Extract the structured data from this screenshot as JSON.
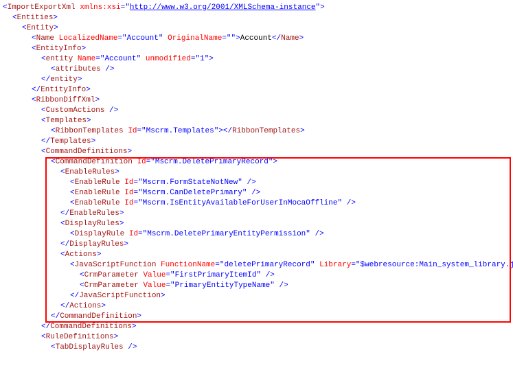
{
  "xml": {
    "root_tag": "ImportExportXml",
    "root_ns_attr": "xmlns:xsi",
    "root_ns_val": "http://www.w3.org/2001/XMLSchema-instance",
    "entities": "Entities",
    "entity": "Entity",
    "name_tag": "Name",
    "name_attr1": "LocalizedName",
    "name_val1": "Account",
    "name_attr2": "OriginalName",
    "name_val2": "",
    "name_text": "Account",
    "entityinfo": "EntityInfo",
    "entity_lc": "entity",
    "entity_lc_attr1": "Name",
    "entity_lc_val1": "Account",
    "entity_lc_attr2": "unmodified",
    "entity_lc_val2": "1",
    "attributes": "attributes",
    "ribbon": "RibbonDiffXml",
    "customactions": "CustomActions",
    "templates": "Templates",
    "ribbontemplates": "RibbonTemplates",
    "ribbontemplates_attr": "Id",
    "ribbontemplates_val": "Mscrm.Templates",
    "commanddefs": "CommandDefinitions",
    "commanddef": "CommandDefinition",
    "commanddef_attr": "Id",
    "commanddef_val": "Mscrm.DeletePrimaryRecord",
    "enablerules": "EnableRules",
    "enablerule": "EnableRule",
    "enablerule_attr": "Id",
    "enablerule1_val": "Mscrm.FormStateNotNew",
    "enablerule2_val": "Mscrm.CanDeletePrimary",
    "enablerule3_val": "Mscrm.IsEntityAvailableForUserInMocaOffline",
    "displayrules": "DisplayRules",
    "displayrule": "DisplayRule",
    "displayrule_attr": "Id",
    "displayrule_val": "Mscrm.DeletePrimaryEntityPermission",
    "actions": "Actions",
    "jsfunc": "JavaScriptFunction",
    "jsfunc_attr1": "FunctionName",
    "jsfunc_val1": "deletePrimaryRecord",
    "jsfunc_attr2": "Library",
    "jsfunc_val2": "$webresource:Main_system_library.js",
    "crmparam": "CrmParameter",
    "crmparam_attr": "Value",
    "crmparam1_val": "FirstPrimaryItemId",
    "crmparam2_val": "PrimaryEntityTypeName",
    "ruledefs": "RuleDefinitions",
    "tabdisplayrules": "TabDisplayRules"
  }
}
